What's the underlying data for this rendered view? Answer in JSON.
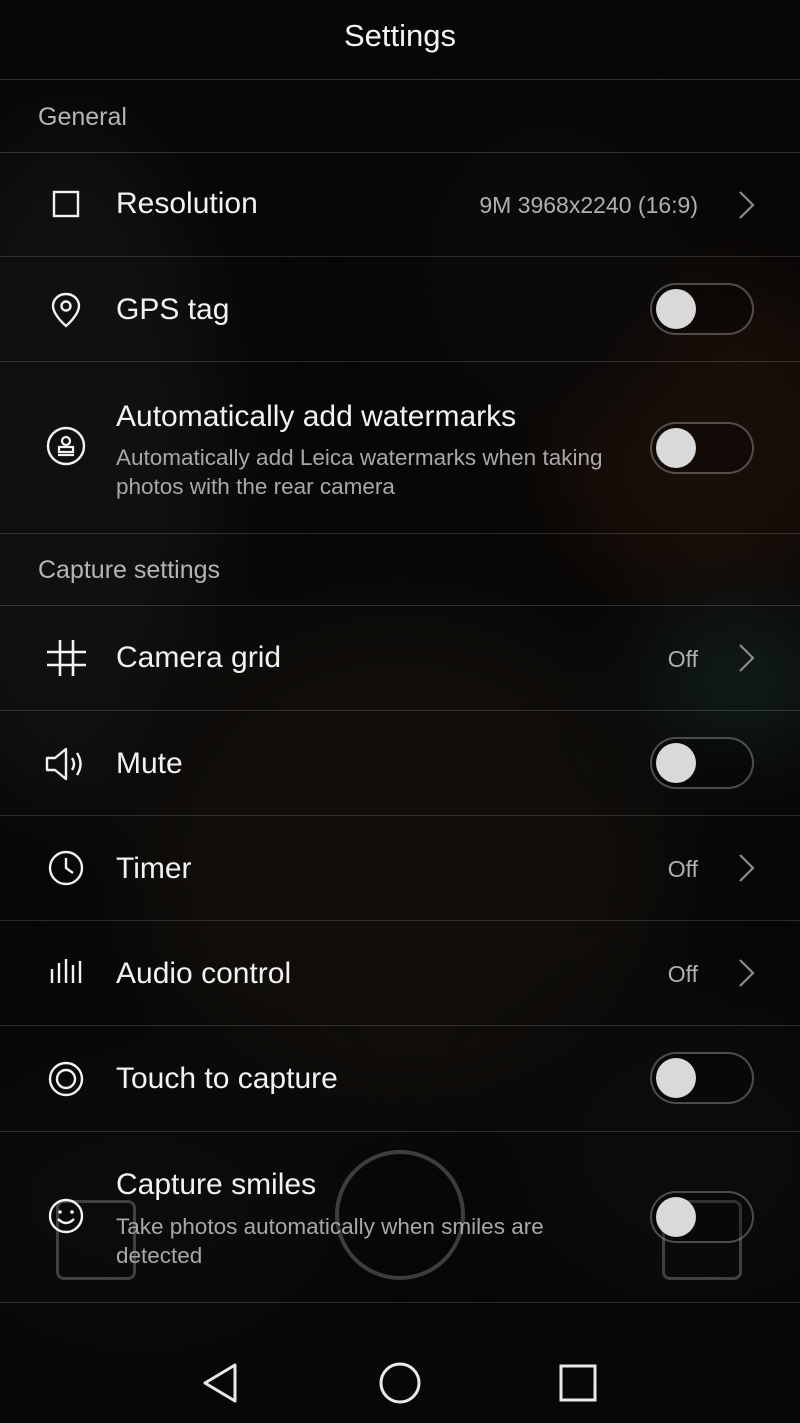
{
  "header": {
    "title": "Settings"
  },
  "sections": {
    "general": {
      "label": "General"
    },
    "capture": {
      "label": "Capture settings"
    }
  },
  "settings": {
    "resolution": {
      "label": "Resolution",
      "value": "9M 3968x2240 (16:9)",
      "icon": "aspect-ratio-icon"
    },
    "gps_tag": {
      "label": "GPS tag",
      "enabled": false,
      "icon": "location-pin-icon"
    },
    "watermarks": {
      "label": "Automatically add watermarks",
      "description": "Automatically add Leica watermarks when taking photos with the rear camera",
      "enabled": false,
      "icon": "watermark-stamp-icon"
    },
    "camera_grid": {
      "label": "Camera grid",
      "value": "Off",
      "icon": "grid-icon"
    },
    "mute": {
      "label": "Mute",
      "enabled": false,
      "icon": "speaker-icon"
    },
    "timer": {
      "label": "Timer",
      "value": "Off",
      "icon": "clock-icon"
    },
    "audio_control": {
      "label": "Audio control",
      "value": "Off",
      "icon": "audio-bars-icon"
    },
    "touch_to_capture": {
      "label": "Touch to capture",
      "enabled": false,
      "icon": "target-icon"
    },
    "capture_smiles": {
      "label": "Capture smiles",
      "description": "Take photos automatically when smiles are detected",
      "enabled": false,
      "icon": "smile-icon"
    }
  },
  "navigation": {
    "back": "back-triangle-icon",
    "home": "home-circle-icon",
    "recents": "recents-square-icon"
  },
  "colors": {
    "text_primary": "#f2f2f2",
    "text_secondary": "#a8a8a8",
    "switch_knob": "#d9d9d9"
  }
}
